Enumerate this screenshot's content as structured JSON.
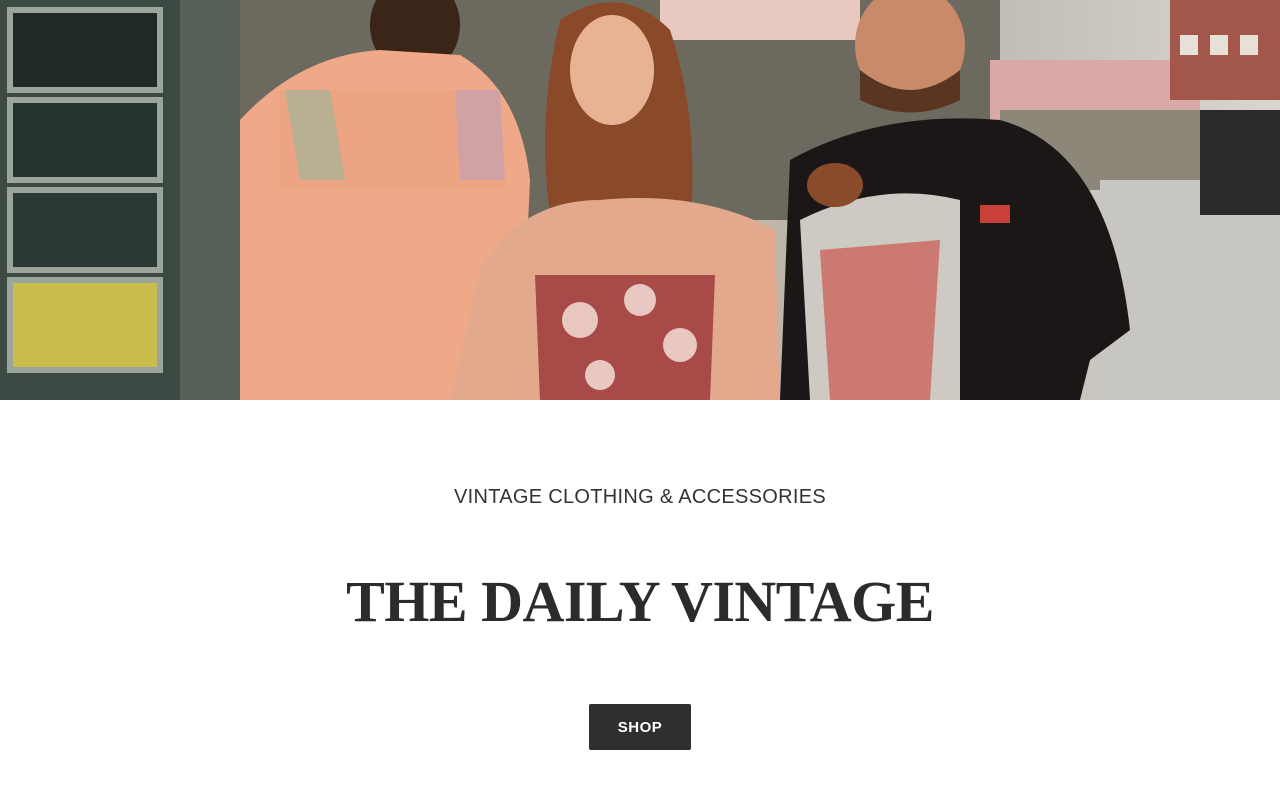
{
  "hero": {
    "image_description_icon": "hero-photo-icon"
  },
  "content": {
    "kicker": "VINTAGE CLOTHING & ACCESSORIES",
    "title": "THE DAILY VINTAGE",
    "shop_label": "SHOP"
  },
  "colors": {
    "text": "#333333",
    "title": "#2b2b2b",
    "button_bg": "#2f2f2f",
    "button_text": "#ffffff"
  }
}
